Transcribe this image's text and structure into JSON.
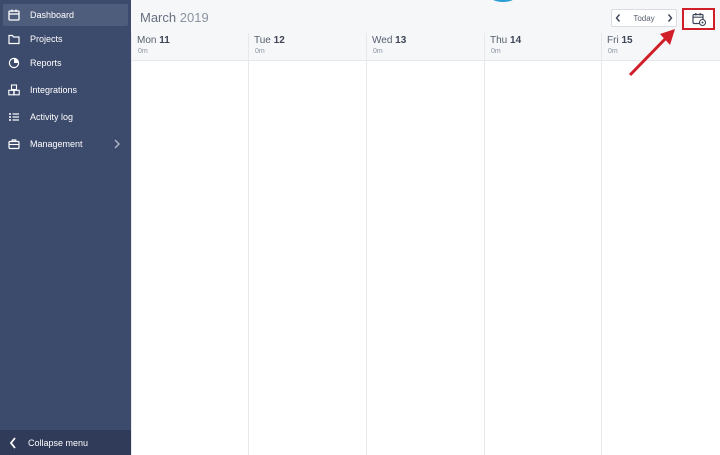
{
  "sidebar": {
    "items": [
      {
        "label": "Dashboard",
        "icon": "calendar-icon",
        "active": true
      },
      {
        "label": "Projects",
        "icon": "folder-icon"
      },
      {
        "label": "Reports",
        "icon": "pie-chart-icon"
      },
      {
        "label": "Integrations",
        "icon": "cubes-icon"
      },
      {
        "label": "Activity log",
        "icon": "list-icon"
      },
      {
        "label": "Management",
        "icon": "briefcase-icon"
      }
    ],
    "collapse_label": "Collapse menu"
  },
  "header": {
    "month": "March",
    "year": "2019",
    "today_label": "Today",
    "prev_icon": "chevron-left-icon",
    "next_icon": "chevron-right-icon",
    "calendar_settings_icon": "calendar-gear-icon"
  },
  "week": {
    "days": [
      {
        "weekday": "Mon",
        "day": "11",
        "total": "0m"
      },
      {
        "weekday": "Tue",
        "day": "12",
        "total": "0m"
      },
      {
        "weekday": "Wed",
        "day": "13",
        "total": "0m"
      },
      {
        "weekday": "Thu",
        "day": "14",
        "total": "0m"
      },
      {
        "weekday": "Fri",
        "day": "15",
        "total": "0m"
      }
    ]
  },
  "colors": {
    "sidebar_bg": "#3c4a6c",
    "sidebar_active": "#4f5d7d",
    "highlight_red": "#d11f2a",
    "accent_blue": "#2a9fd8"
  }
}
